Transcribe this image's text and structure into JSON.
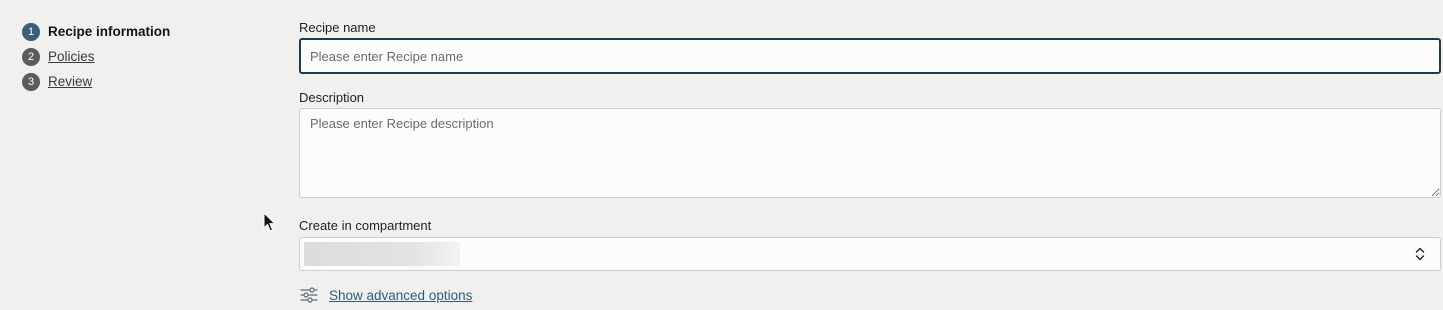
{
  "steps": [
    {
      "number": "1",
      "label": "Recipe information",
      "state": "active"
    },
    {
      "number": "2",
      "label": "Policies",
      "state": "todo"
    },
    {
      "number": "3",
      "label": "Review",
      "state": "todo"
    }
  ],
  "form": {
    "recipe_name": {
      "label": "Recipe name",
      "placeholder": "Please enter Recipe name",
      "value": ""
    },
    "description": {
      "label": "Description",
      "placeholder": "Please enter Recipe description",
      "value": ""
    },
    "compartment": {
      "label": "Create in compartment",
      "selected": ""
    },
    "advanced_link": "Show advanced options"
  },
  "icons": {
    "select": "chevron-up-down-icon",
    "advanced": "sliders-icon",
    "cursor": "mouse-pointer-icon"
  },
  "colors": {
    "active_step": "#3a5f78",
    "inactive_step": "#5b5b5b",
    "link": "#2f5b78",
    "focus_border": "#1e3b4a"
  }
}
